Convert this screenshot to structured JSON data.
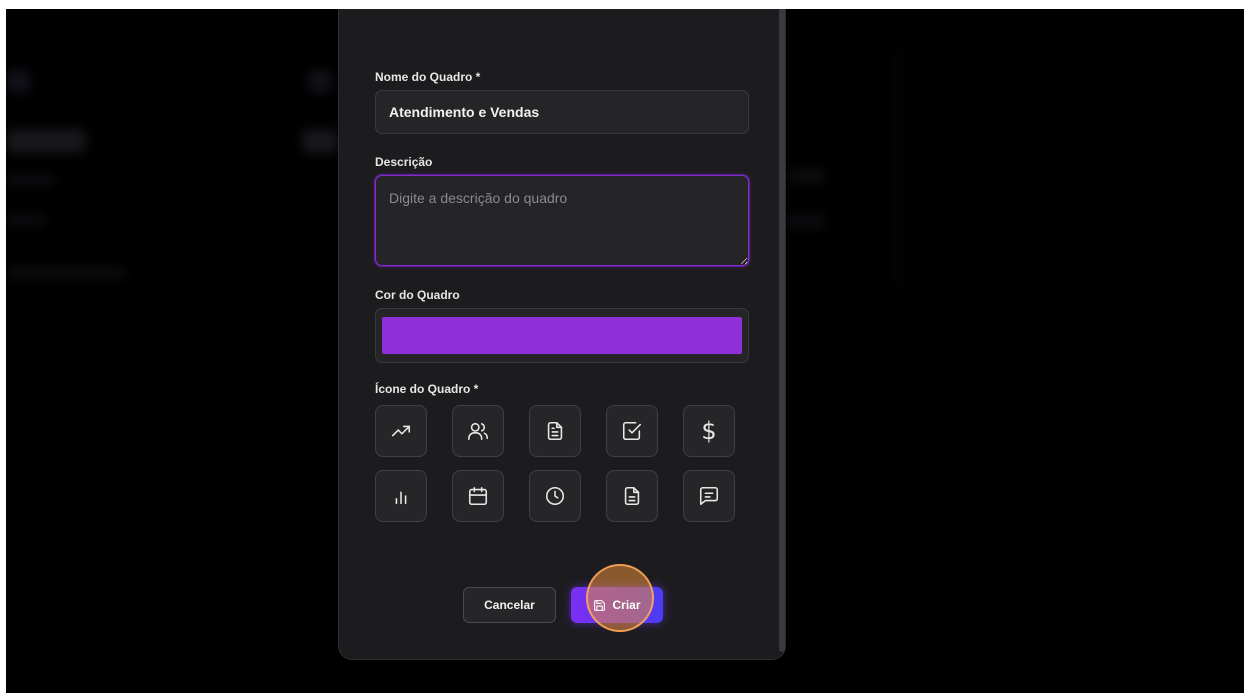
{
  "form": {
    "name_label": "Nome do Quadro *",
    "name_value": "Atendimento e Vendas",
    "description_label": "Descrição",
    "description_placeholder": "Digite a descrição do quadro",
    "color_label": "Cor do Quadro",
    "color_value": "#8e2fd9",
    "icon_label": "Ícone do Quadro *",
    "icons": [
      "trending-up-icon",
      "users-icon",
      "file-text-icon",
      "check-square-icon",
      "dollar-sign-icon",
      "bar-chart-icon",
      "calendar-icon",
      "clock-icon",
      "file-icon",
      "message-square-icon"
    ]
  },
  "actions": {
    "cancel_label": "Cancelar",
    "create_label": "Criar"
  },
  "colors": {
    "accent": "#7b2ff2",
    "modal_bg": "#1c1c1e",
    "overlay_bg": "#000000"
  }
}
